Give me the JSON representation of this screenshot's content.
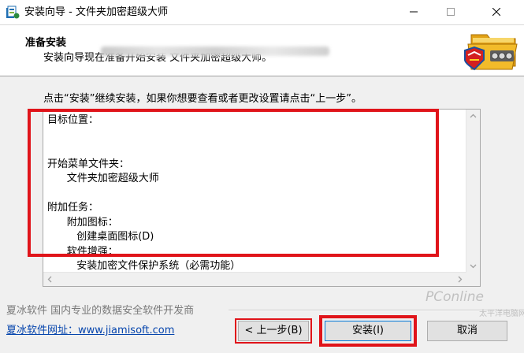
{
  "window": {
    "title": "安装向导 - 文件夹加密超级大师"
  },
  "header": {
    "title": "准备安装",
    "description": "安装向导现在准备开始安装 文件夹加密超级大师。"
  },
  "main": {
    "instruction": "点击“安装”继续安装，如果你想要查看或者更改设置请点击“上一步”。",
    "memo_text": "目标位置：\n\n\n开始菜单文件夹：\n      文件夹加密超级大师\n\n附加任务：\n      附加图标：\n         创建桌面图标(D)\n      软件增强：\n         安装加密文件保护系统（必需功能）"
  },
  "footer": {
    "company": "夏冰软件  国内专业的数据安全软件开发商",
    "url_text": "夏冰软件网址：www.jiamisoft.com",
    "back_label": "< 上一步(B)",
    "install_label": "安装(I)",
    "cancel_label": "取消",
    "watermark": "PConline",
    "watermark_sub": "太平洋电脑网"
  },
  "colors": {
    "highlight": "#e0141a",
    "link": "#0645ad",
    "accent": "#0078d7"
  },
  "icons": [
    "app-icon",
    "minimize-icon",
    "maximize-icon",
    "close-icon",
    "folder-lock-logo-icon"
  ]
}
